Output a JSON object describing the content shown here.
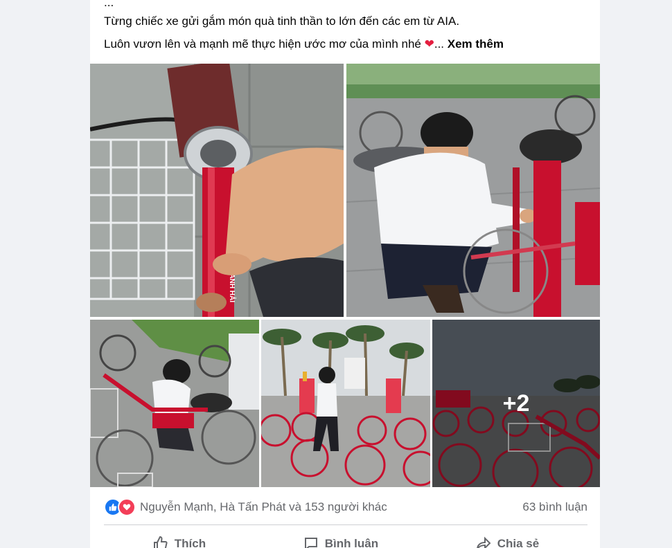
{
  "post": {
    "ellipsis_line": "...",
    "line1": "Từng chiếc xe gửi gắm món quà tinh thần  to lớn đến các em từ AIA.",
    "line2": "Luôn vươn lên và mạnh mẽ thực hiện ước mơ của mình nhé ",
    "heart_glyph": "❤",
    "dots": "...",
    "see_more": "Xem thêm"
  },
  "photos": {
    "more_count": "+2",
    "frame_text": "THANH HẢI"
  },
  "reactions": {
    "names": "Nguyễn Mạnh, Hà Tấn Phát và 153 người khác",
    "comments": "63 bình luận",
    "icons": [
      "like-icon",
      "love-icon"
    ]
  },
  "actions": {
    "like": "Thích",
    "comment": "Bình luận",
    "share": "Chia sẻ"
  },
  "colors": {
    "like_blue": "#1877f2",
    "love_red": "#f33e58",
    "text_secondary": "#65676b"
  }
}
